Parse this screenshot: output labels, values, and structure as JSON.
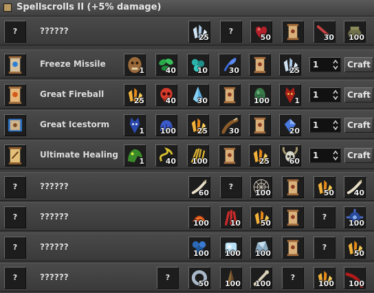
{
  "window": {
    "title": "Spellscrolls II (+5% damage)"
  },
  "ui": {
    "craft_label": "Craft",
    "unknown_mark": "?"
  },
  "recipes": [
    {
      "name": "??????",
      "product_icon": "unknown",
      "known": false,
      "ingredients": [
        {
          "icon": "crystal-cluster",
          "count": "25"
        },
        {
          "icon": "unknown",
          "count": ""
        },
        {
          "icon": "heart",
          "count": "50"
        },
        {
          "icon": "scroll",
          "count": ""
        },
        {
          "icon": "feather-potion",
          "count": "30"
        },
        {
          "icon": "pot",
          "count": "100"
        }
      ]
    },
    {
      "name": "Freeze Missile",
      "product_icon": "scroll-blue",
      "known": true,
      "quantity": "1",
      "ingredients": [
        {
          "icon": "orc-head",
          "count": "1"
        },
        {
          "icon": "green-leaves",
          "count": "40"
        },
        {
          "icon": "teal-orbs",
          "count": "10"
        },
        {
          "icon": "blue-feather",
          "count": "30"
        },
        {
          "icon": "scroll",
          "count": ""
        },
        {
          "icon": "crystal-cluster",
          "count": "25"
        }
      ]
    },
    {
      "name": "Great Fireball",
      "product_icon": "scroll-orange",
      "known": true,
      "quantity": "1",
      "ingredients": [
        {
          "icon": "gold-crystal",
          "count": "25"
        },
        {
          "icon": "red-skull",
          "count": "40"
        },
        {
          "icon": "ice-shard",
          "count": "30"
        },
        {
          "icon": "scroll",
          "count": ""
        },
        {
          "icon": "green-egg",
          "count": "100"
        },
        {
          "icon": "red-demon",
          "count": "1"
        }
      ]
    },
    {
      "name": "Great Icestorm",
      "product_icon": "scroll-ice",
      "known": true,
      "quantity": "1",
      "ingredients": [
        {
          "icon": "blue-demon",
          "count": "1"
        },
        {
          "icon": "blue-pelt",
          "count": "100"
        },
        {
          "icon": "gold-crystal",
          "count": "25"
        },
        {
          "icon": "brown-claw",
          "count": "30"
        },
        {
          "icon": "scroll",
          "count": ""
        },
        {
          "icon": "blue-gem",
          "count": "20"
        }
      ]
    },
    {
      "name": "Ultimate Healing",
      "product_icon": "scroll-gold",
      "known": true,
      "quantity": "1",
      "ingredients": [
        {
          "icon": "green-beast",
          "count": "1"
        },
        {
          "icon": "yellow-rope",
          "count": "40"
        },
        {
          "icon": "yellow-straw",
          "count": "100"
        },
        {
          "icon": "scroll",
          "count": ""
        },
        {
          "icon": "gold-crystal",
          "count": "25"
        },
        {
          "icon": "horned-skull",
          "count": "60"
        }
      ]
    },
    {
      "name": "??????",
      "product_icon": "unknown",
      "known": false,
      "ingredients": [
        {
          "icon": "bone-claw",
          "count": "60"
        },
        {
          "icon": "unknown",
          "count": ""
        },
        {
          "icon": "cobweb",
          "count": "100"
        },
        {
          "icon": "scroll",
          "count": ""
        },
        {
          "icon": "gold-crystal",
          "count": "50"
        },
        {
          "icon": "bone-claw",
          "count": "40"
        }
      ]
    },
    {
      "name": "??????",
      "product_icon": "unknown",
      "known": false,
      "ingredients": [
        {
          "icon": "fire-shell",
          "count": "100"
        },
        {
          "icon": "red-claws",
          "count": "10"
        },
        {
          "icon": "gold-crystal",
          "count": "50"
        },
        {
          "icon": "scroll",
          "count": ""
        },
        {
          "icon": "unknown",
          "count": ""
        },
        {
          "icon": "blue-gear",
          "count": "100"
        }
      ]
    },
    {
      "name": "??????",
      "product_icon": "unknown",
      "known": false,
      "ingredients": [
        {
          "icon": "blue-scales",
          "count": "100"
        },
        {
          "icon": "ice-cube",
          "count": "100"
        },
        {
          "icon": "ice-ore",
          "count": "100"
        },
        {
          "icon": "scroll",
          "count": ""
        },
        {
          "icon": "unknown",
          "count": ""
        },
        {
          "icon": "gold-crystal",
          "count": "50"
        }
      ]
    },
    {
      "name": "??????",
      "product_icon": "unknown",
      "known": false,
      "ingredients": [
        {
          "icon": "unknown",
          "count": ""
        },
        {
          "icon": "steel-ring",
          "count": "50"
        },
        {
          "icon": "brown-spike",
          "count": "100"
        },
        {
          "icon": "bone",
          "count": "100"
        },
        {
          "icon": "unknown",
          "count": ""
        },
        {
          "icon": "gold-crystal",
          "count": "100"
        },
        {
          "icon": "red-fang",
          "count": "100"
        }
      ]
    }
  ]
}
